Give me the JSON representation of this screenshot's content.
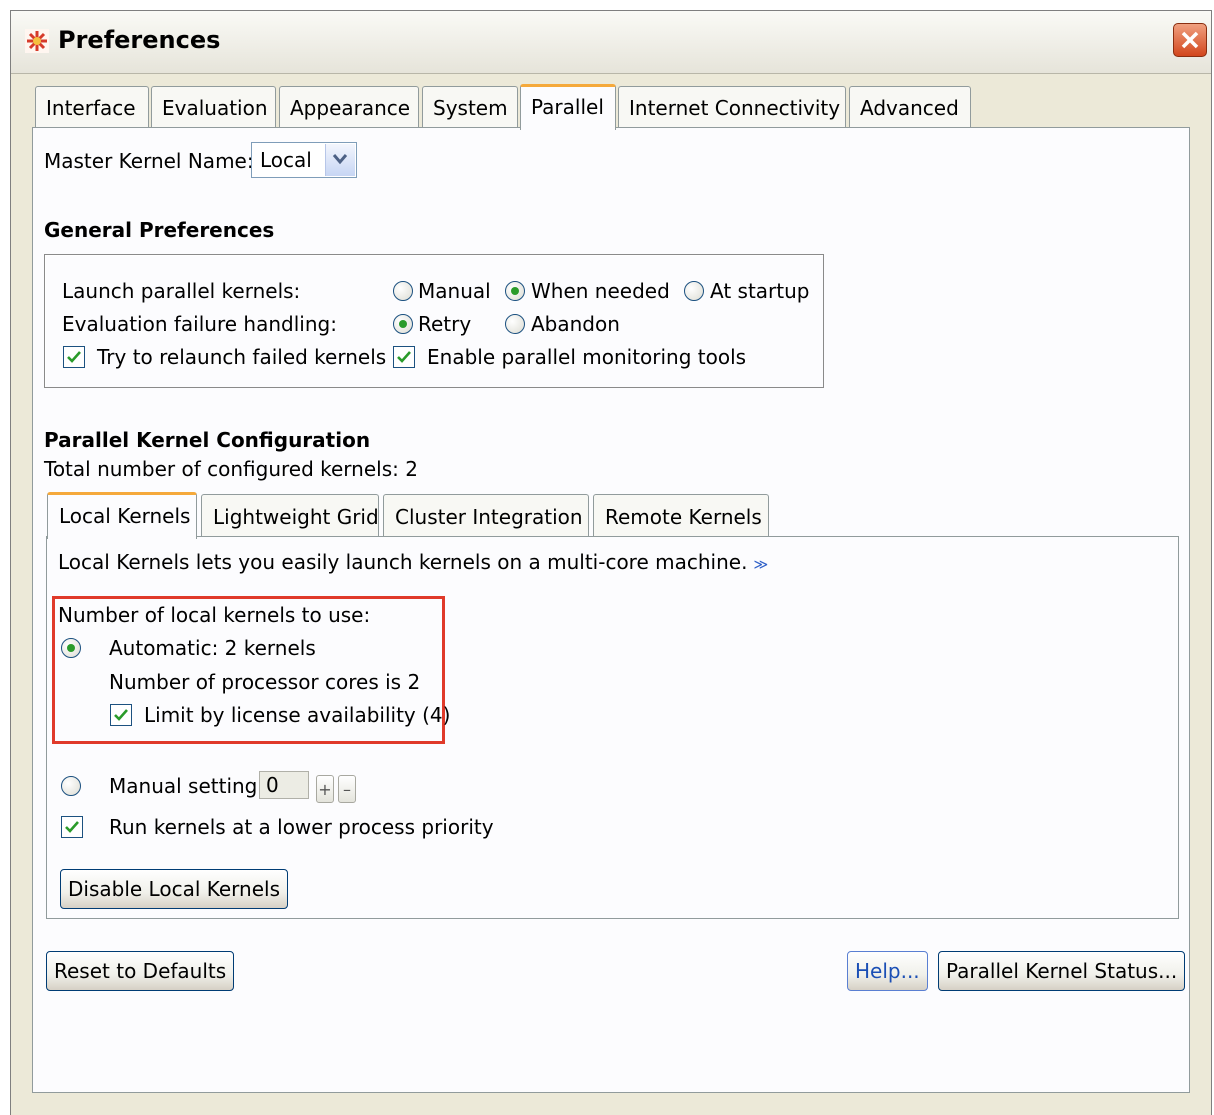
{
  "window": {
    "title": "Preferences"
  },
  "tabs": [
    {
      "label": "Interface"
    },
    {
      "label": "Evaluation"
    },
    {
      "label": "Appearance"
    },
    {
      "label": "System"
    },
    {
      "label": "Parallel",
      "active": true
    },
    {
      "label": "Internet Connectivity"
    },
    {
      "label": "Advanced"
    }
  ],
  "master_kernel": {
    "label": "Master Kernel Name:",
    "value": "Local"
  },
  "general": {
    "heading": "General Preferences",
    "launch_label": "Launch parallel kernels:",
    "launch_options": [
      "Manual",
      "When needed",
      "At startup"
    ],
    "launch_selected": "When needed",
    "failure_label": "Evaluation failure handling:",
    "failure_options": [
      "Retry",
      "Abandon"
    ],
    "failure_selected": "Retry",
    "relaunch_label": "Try to relaunch failed kernels",
    "relaunch_checked": true,
    "monitoring_label": "Enable parallel monitoring tools",
    "monitoring_checked": true
  },
  "config": {
    "heading": "Parallel Kernel Configuration",
    "total": "Total number of configured kernels: 2"
  },
  "subtabs": [
    {
      "label": "Local Kernels",
      "active": true
    },
    {
      "label": "Lightweight Grid"
    },
    {
      "label": "Cluster Integration"
    },
    {
      "label": "Remote Kernels"
    }
  ],
  "local": {
    "description": "Local Kernels lets you easily launch kernels on a multi-core machine.",
    "number_label": "Number of local kernels to use:",
    "automatic_label": "Automatic: 2 kernels",
    "automatic_selected": true,
    "cores_label": "Number of processor cores is 2",
    "limit_label": "Limit by license availability (4)",
    "limit_checked": true,
    "manual_label": "Manual setting",
    "manual_value": "0",
    "priority_label": "Run kernels at a lower process priority",
    "priority_checked": true,
    "disable_button": "Disable Local Kernels"
  },
  "footer": {
    "reset_button": "Reset to Defaults",
    "help_button": "Help...",
    "status_button": "Parallel Kernel Status..."
  },
  "colors": {
    "highlight": "#e03a2a",
    "tab_accent": "#f5a93b",
    "check_green": "#2a9b2a"
  }
}
